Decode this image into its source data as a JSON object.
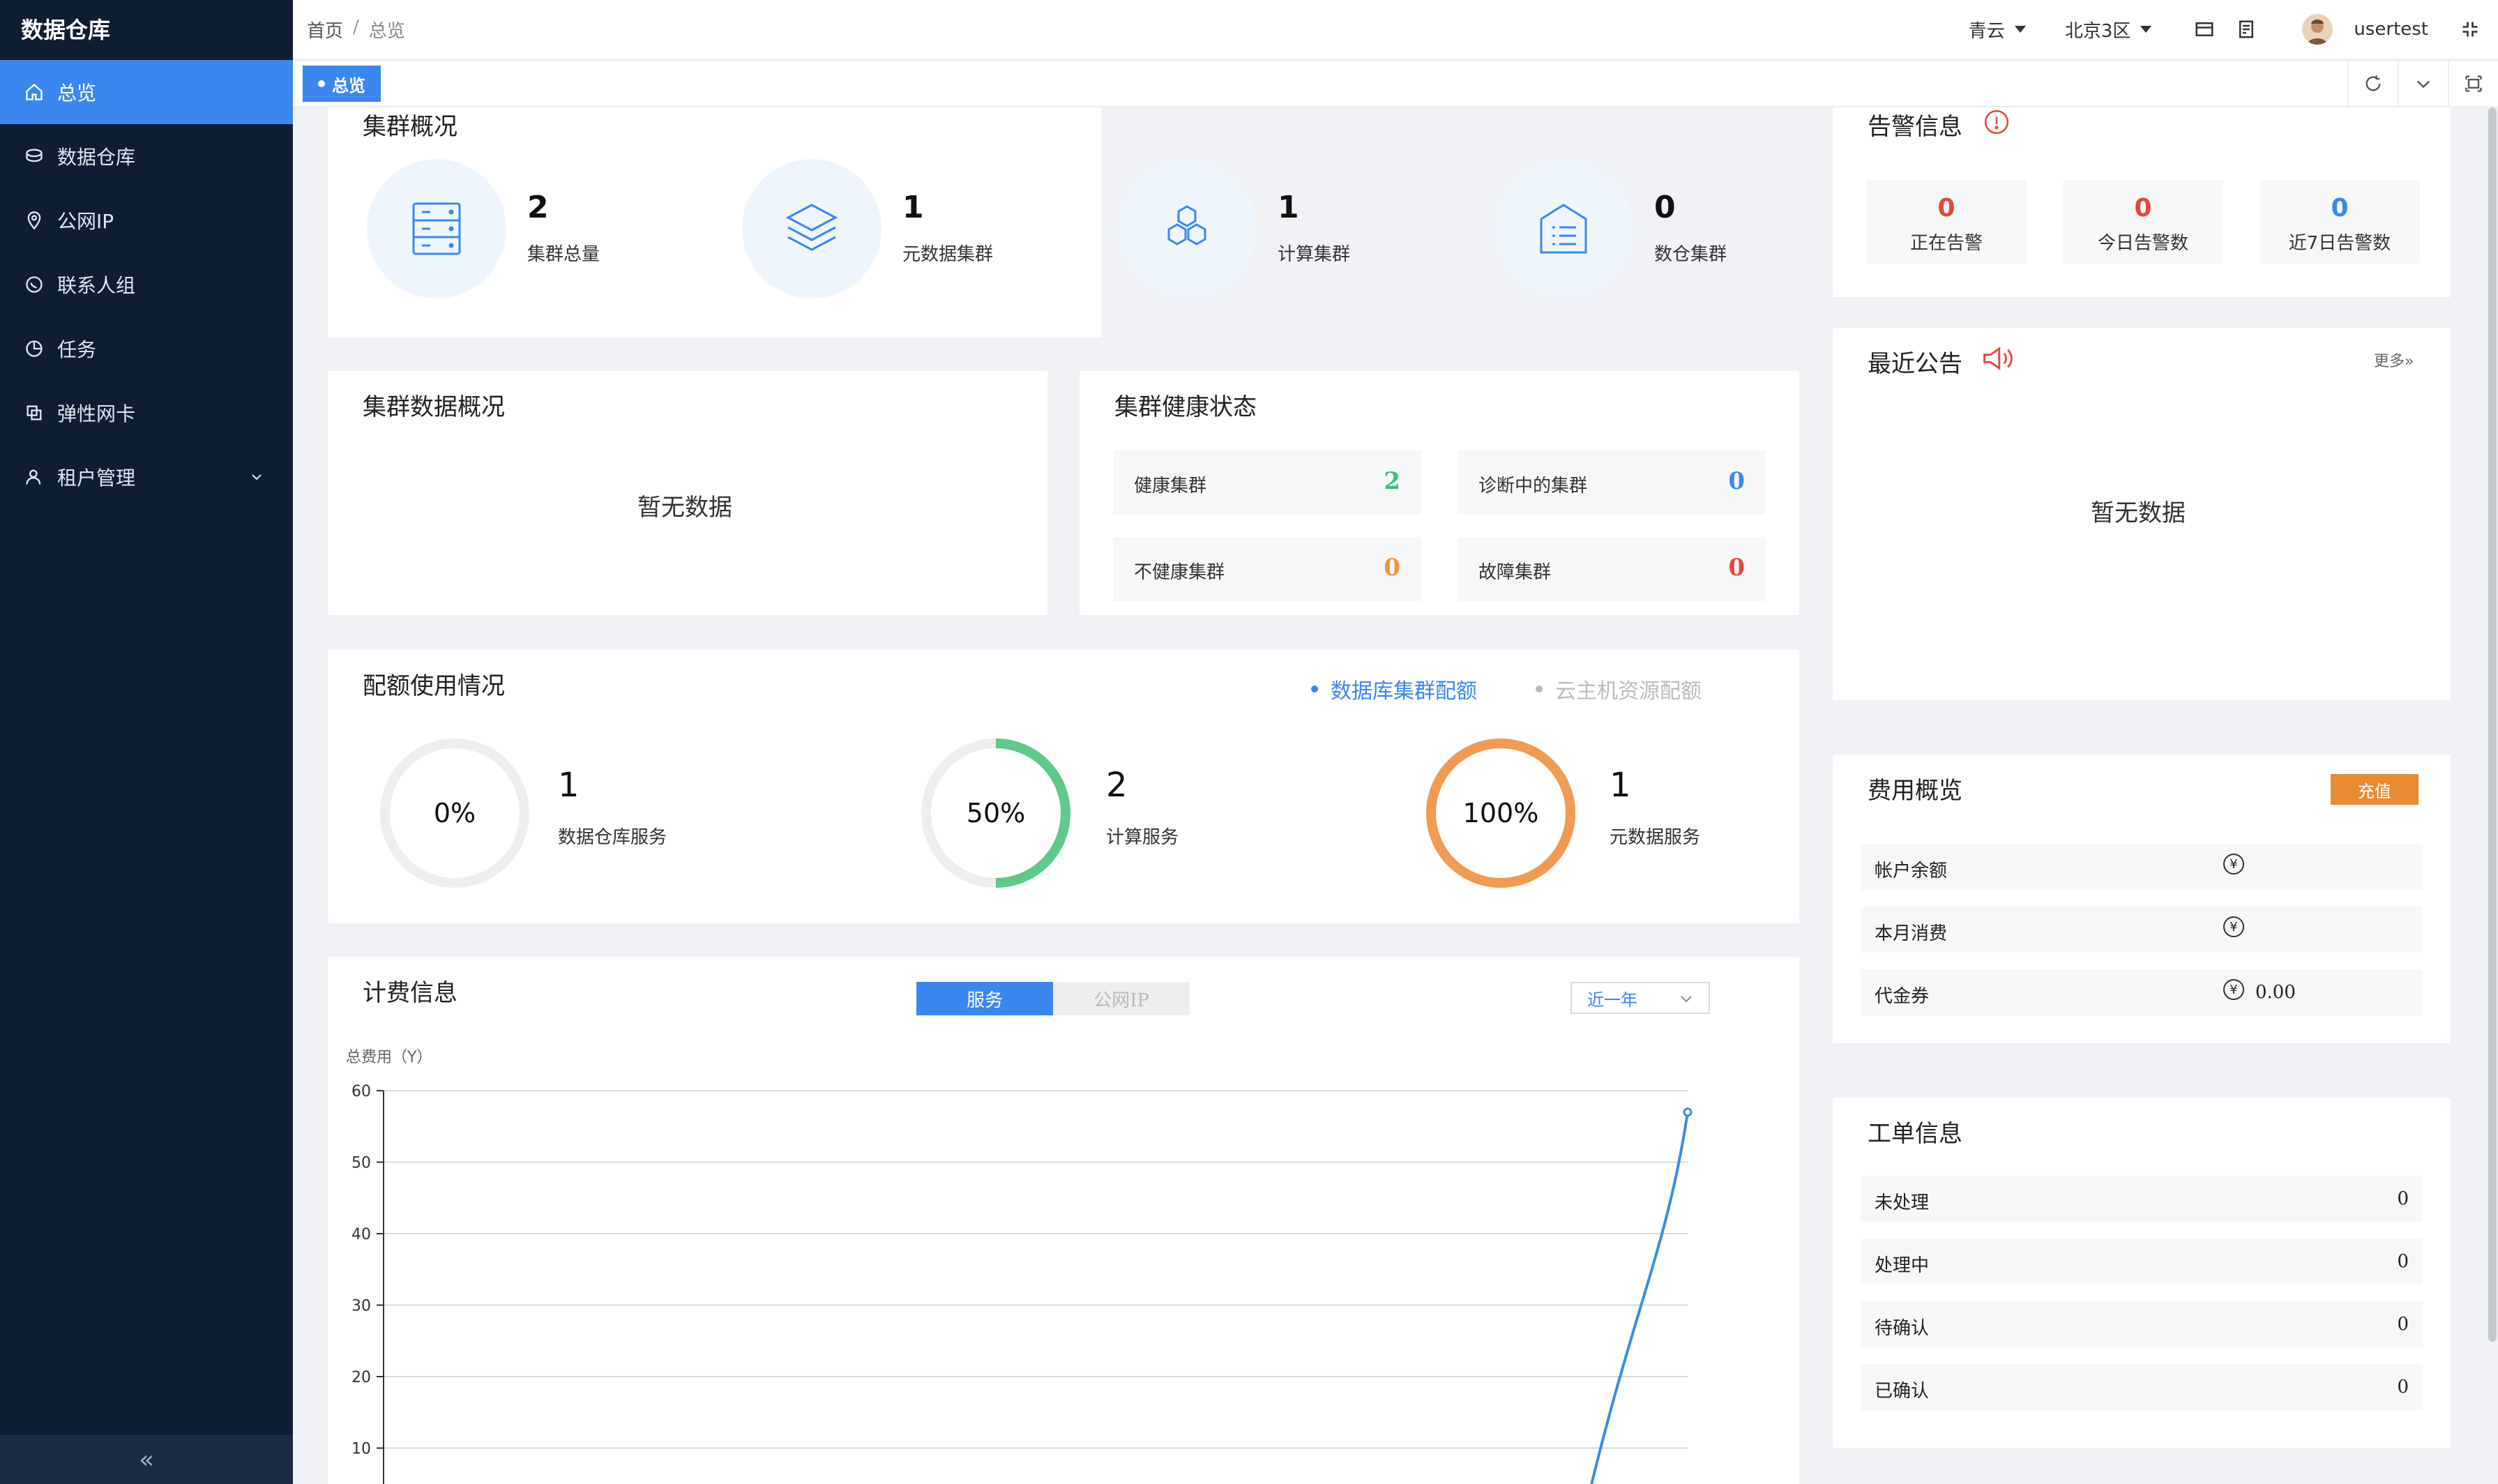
{
  "app": {
    "title": "数据仓库"
  },
  "sidebar": {
    "items": [
      {
        "label": "总览",
        "icon": "home-icon",
        "active": true
      },
      {
        "label": "数据仓库",
        "icon": "warehouse-icon"
      },
      {
        "label": "公网IP",
        "icon": "location-pin-icon"
      },
      {
        "label": "联系人组",
        "icon": "chat-bubble-icon"
      },
      {
        "label": "任务",
        "icon": "pie-icon"
      },
      {
        "label": "弹性网卡",
        "icon": "copy-icon"
      },
      {
        "label": "租户管理",
        "icon": "user-icon",
        "expandable": true
      }
    ],
    "collapse_label": "«"
  },
  "header": {
    "breadcrumb": {
      "home": "首页",
      "sep": "/",
      "current": "总览"
    },
    "cloud": "青云",
    "region": "北京3区",
    "user": "usertest"
  },
  "tabs": [
    {
      "label": "总览"
    }
  ],
  "overview": {
    "title": "集群概况",
    "stats": [
      {
        "value": "2",
        "label": "集群总量",
        "icon": "server-icon"
      },
      {
        "value": "1",
        "label": "元数据集群",
        "icon": "layers-icon"
      },
      {
        "value": "1",
        "label": "计算集群",
        "icon": "hexagons-icon"
      },
      {
        "value": "0",
        "label": "数仓集群",
        "icon": "warehouse-list-icon"
      }
    ]
  },
  "cluster_data": {
    "title": "集群数据概况",
    "empty": "暂无数据"
  },
  "health": {
    "title": "集群健康状态",
    "items": [
      {
        "label": "健康集群",
        "value": "2",
        "color": "#3cbf7e"
      },
      {
        "label": "诊断中的集群",
        "value": "0",
        "color": "#3b87f0"
      },
      {
        "label": "不健康集群",
        "value": "0",
        "color": "#f0943c"
      },
      {
        "label": "故障集群",
        "value": "0",
        "color": "#e8463c"
      }
    ]
  },
  "quota": {
    "title": "配额使用情况",
    "tabs": [
      {
        "label": "数据库集群配额",
        "active": true
      },
      {
        "label": "云主机资源配额"
      }
    ],
    "items": [
      {
        "percent_label": "0%",
        "percent": 0,
        "value": "1",
        "label": "数据仓库服务",
        "color": "#eeeeee"
      },
      {
        "percent_label": "50%",
        "percent": 50,
        "value": "2",
        "label": "计算服务",
        "color": "#5fc98a"
      },
      {
        "percent_label": "100%",
        "percent": 100,
        "value": "1",
        "label": "元数据服务",
        "color": "#f09a52"
      }
    ]
  },
  "billing": {
    "title": "计费信息",
    "segments": [
      {
        "label": "服务",
        "active": true
      },
      {
        "label": "公网IP"
      }
    ],
    "range": "近一年",
    "ylabel": "总费用（Y）"
  },
  "chart_data": {
    "type": "line",
    "ylabel": "总费用（Y）",
    "yticks": [
      60,
      50,
      40,
      30,
      20,
      10
    ],
    "ylim": [
      0,
      60
    ],
    "series": [
      {
        "values": [
          0,
          0,
          0,
          0,
          0,
          0,
          0,
          0,
          0,
          0,
          0,
          57
        ]
      }
    ],
    "visible_ylim": [
      10,
      60
    ]
  },
  "alerts": {
    "title": "告警信息",
    "items": [
      {
        "value": "0",
        "label": "正在告警",
        "color": "#e8463c"
      },
      {
        "value": "0",
        "label": "今日告警数",
        "color": "#e8463c"
      },
      {
        "value": "0",
        "label": "近7日告警数",
        "color": "#3b87f0"
      }
    ]
  },
  "notice": {
    "title": "最近公告",
    "more": "更多»",
    "empty": "暂无数据"
  },
  "fees": {
    "title": "费用概览",
    "recharge": "充值",
    "rows": [
      {
        "label": "帐户余额",
        "currency": "¥",
        "value": ""
      },
      {
        "label": "本月消费",
        "currency": "¥",
        "value": ""
      },
      {
        "label": "代金券",
        "currency": "¥",
        "value": "0.00"
      }
    ]
  },
  "tickets": {
    "title": "工单信息",
    "rows": [
      {
        "label": "未处理",
        "value": "0"
      },
      {
        "label": "处理中",
        "value": "0"
      },
      {
        "label": "待确认",
        "value": "0"
      },
      {
        "label": "已确认",
        "value": "0"
      }
    ]
  }
}
